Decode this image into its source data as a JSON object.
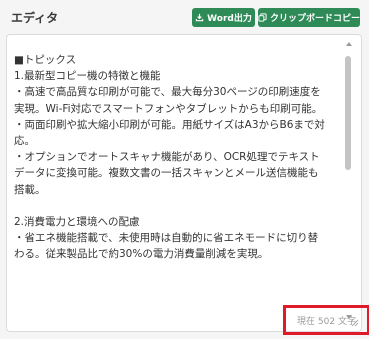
{
  "header": {
    "title": "エディタ",
    "word_button_label": "Word出力",
    "copy_button_label": "クリップボードコピー"
  },
  "editor": {
    "lines": [
      "■トピックス",
      "1.最新型コピー機の特徴と機能",
      "・高速で高品質な印刷が可能で、最大毎分30ページの印刷速度を",
      "実現。Wi-Fi対応でスマートフォンやタブレットからも印刷可能。",
      "・両面印刷や拡大縮小印刷が可能。用紙サイズはA3からB6まで対",
      "応。",
      "・オプションでオートスキャナ機能があり、OCR処理でテキスト",
      "データに変換可能。複数文書の一括スキャンとメール送信機能も",
      "搭載。",
      "",
      "2.消費電力と環境への配慮",
      "・省エネ機能搭載で、未使用時は自動的に省エネモードに切り替",
      "わる。従来製品比で約30%の電力消費量削減を実現。"
    ]
  },
  "status": {
    "char_count": "現在 502 文字"
  },
  "colors": {
    "accent": "#2e8b57",
    "highlight_border": "#e01a2b"
  },
  "icons": {
    "word": "download-icon",
    "copy": "copy-icon"
  }
}
